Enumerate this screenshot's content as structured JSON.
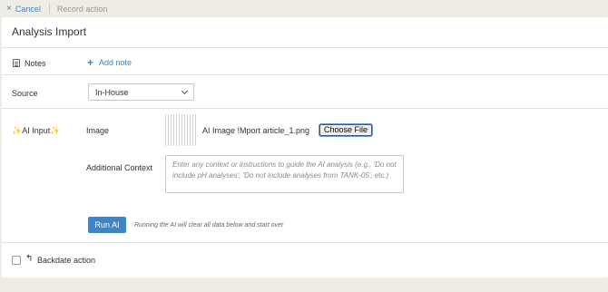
{
  "topbar": {
    "cancel_label": "Cancel",
    "cancel_icon": "×",
    "breadcrumb": "Record action"
  },
  "page": {
    "title": "Analysis Import"
  },
  "notes": {
    "label": "Notes",
    "add_label": "Add note",
    "add_icon": "+"
  },
  "source": {
    "label": "Source",
    "selected": "In-House"
  },
  "ai_input": {
    "label": "AI Input",
    "sparkle": "✨",
    "image_label": "Image",
    "file_name": "AI Image !Mport article_1.png",
    "choose_file_label": "Choose File",
    "context_label": "Additional Context",
    "context_placeholder": "Enter any context or instructions to guide the AI analysis (e.g., 'Do not include pH analyses', 'Do not include analyses from TANK-05', etc.)",
    "run_label": "Run AI",
    "run_hint": "Running the AI will clear all data below and start over"
  },
  "backdate": {
    "label": "Backdate action",
    "checked": false,
    "icon": "↰"
  },
  "colors": {
    "accent": "#3d85c6",
    "background": "#efece6",
    "card": "#ffffff"
  }
}
